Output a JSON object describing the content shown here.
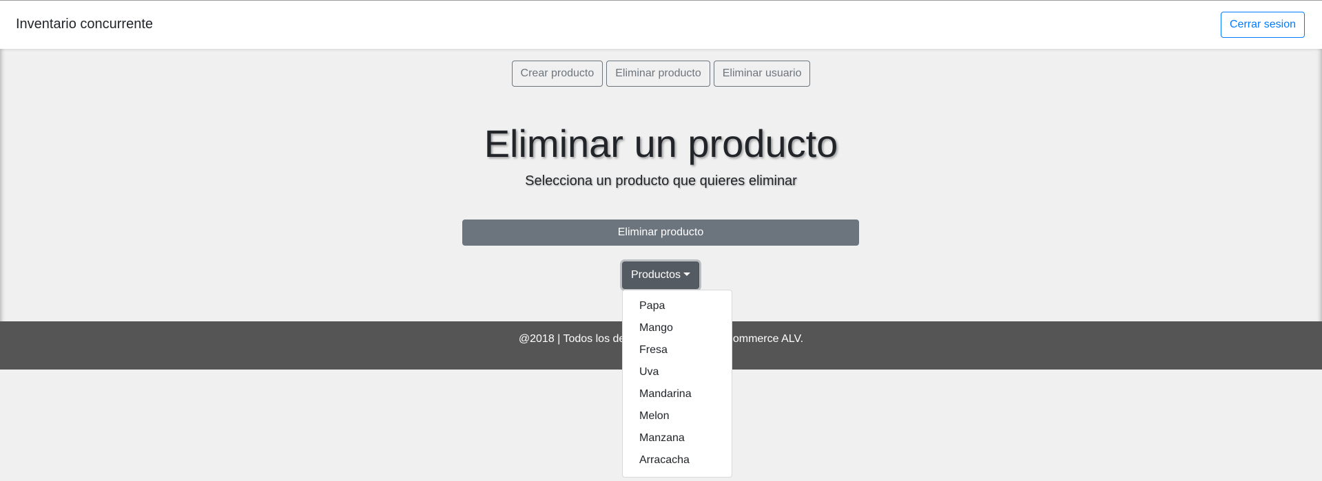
{
  "navbar": {
    "brand": "Inventario concurrente",
    "logout_label": "Cerrar sesion"
  },
  "subnav": {
    "create_label": "Crear producto",
    "delete_product_label": "Eliminar producto",
    "delete_user_label": "Eliminar usuario"
  },
  "main": {
    "title": "Eliminar un producto",
    "subtitle": "Selecciona un producto que quieres eliminar",
    "delete_button_label": "Eliminar producto",
    "dropdown_label": "Productos",
    "dropdown_items": [
      "Papa",
      "Mango",
      "Fresa",
      "Uva",
      "Mandarina",
      "Melon",
      "Manzana",
      "Arracacha"
    ]
  },
  "footer": {
    "text": "@2018 | Todos los derechos reservados eCommerce ALV."
  },
  "colors": {
    "primary": "#007bff",
    "secondary": "#6c757d",
    "footer_bg": "#555555",
    "page_bg": "#f0f0f0"
  }
}
